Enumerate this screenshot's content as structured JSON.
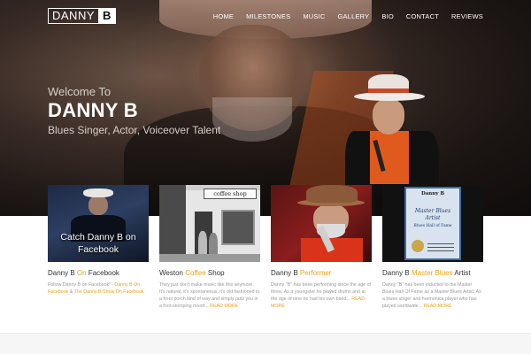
{
  "logo": {
    "part1": "DANNY",
    "part2": "B"
  },
  "nav": {
    "items": [
      "HOME",
      "MILESTONES",
      "MUSIC",
      "GALLERY",
      "BIO",
      "CONTACT",
      "REVIEWS"
    ]
  },
  "hero": {
    "welcome": "Welcome To",
    "title": "DANNY B",
    "subtitle": "Blues Singer, Actor, Voiceover Talent"
  },
  "cards": [
    {
      "image_caption": "Catch Danny B on Facebook",
      "title_pre": "Danny B ",
      "title_accent": "On",
      "title_post": " Facebook",
      "text_pre": "Follow Danny B on Facebook! - ",
      "link1": "Danny B On Facebook",
      "text_mid": " & ",
      "link2": "The Danny B Show On Facebook"
    },
    {
      "image_sign": "coffee shop",
      "title_pre": "Weston ",
      "title_accent": "Coffee",
      "title_post": " Shop",
      "text": "They just don't make music like this anymore. It's natural, it's spontaneous, it's old fashioned in a front porch kind of way and simply puts you in a foot-stomping mood... ",
      "read_more": "READ MORE"
    },
    {
      "title_pre": "Danny B ",
      "title_accent": "Performer",
      "title_post": "",
      "text": "Danny \"B\" has been performing since the age of three. As a youngster he played drums and at the age of nine he had his own band... ",
      "read_more": "READ MORE"
    },
    {
      "cert_name": "Danny B",
      "cert_line1": "Master Blues",
      "cert_line2": "Artist",
      "cert_line3": "Blues Hall of Fame",
      "title_pre": "Danny B ",
      "title_accent": "Master Blues",
      "title_post": " Artist",
      "text": "Danny \"B\" has been inducted to the Master Blues Hall Of Fame as a Master Blues Artist. As a blues singer and harmonica player who has played worldwide... ",
      "read_more": "READ MORE"
    }
  ],
  "colors": {
    "accent": "#e8a317",
    "hero_dark": "#1b1513"
  }
}
